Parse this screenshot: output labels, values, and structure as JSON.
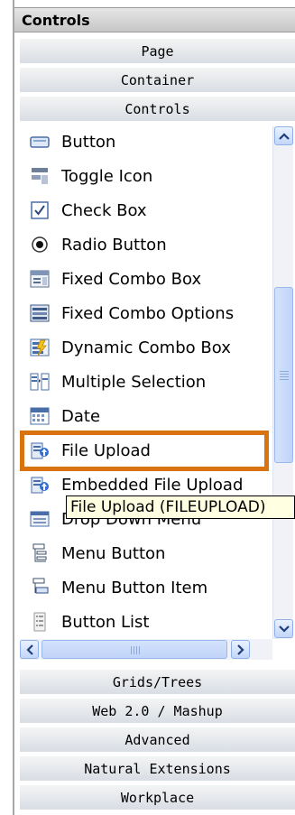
{
  "panel": {
    "title": "Controls"
  },
  "sections_top": [
    "Page",
    "Container",
    "Controls"
  ],
  "items": [
    {
      "label": "Button",
      "icon": "button-icon"
    },
    {
      "label": "Toggle Icon",
      "icon": "toggle-icon"
    },
    {
      "label": "Check Box",
      "icon": "checkbox-icon"
    },
    {
      "label": "Radio Button",
      "icon": "radio-button-icon"
    },
    {
      "label": "Fixed Combo Box",
      "icon": "fixed-combo-box-icon"
    },
    {
      "label": "Fixed Combo Options",
      "icon": "fixed-combo-options-icon"
    },
    {
      "label": "Dynamic Combo Box",
      "icon": "dynamic-combo-box-icon"
    },
    {
      "label": "Multiple Selection",
      "icon": "multiple-selection-icon"
    },
    {
      "label": "Date",
      "icon": "calendar-icon"
    },
    {
      "label": "File Upload",
      "icon": "file-upload-icon"
    },
    {
      "label": "Embedded File Upload",
      "icon": "embedded-file-upload-icon"
    },
    {
      "label": "Drop Down Menu",
      "icon": "drop-down-menu-icon"
    },
    {
      "label": "Menu Button",
      "icon": "menu-button-icon"
    },
    {
      "label": "Menu Button Item",
      "icon": "menu-button-item-icon"
    },
    {
      "label": "Button List",
      "icon": "button-list-icon"
    }
  ],
  "tooltip": "File Upload (FILEUPLOAD)",
  "sections_bottom": [
    "Grids/Trees",
    "Web 2.0 / Mashup",
    "Advanced",
    "Natural Extensions",
    "Workplace"
  ],
  "colors": {
    "highlight": "#d9730f",
    "tooltip_bg": "#ffffe1",
    "scroll": "#c3d6fa"
  }
}
